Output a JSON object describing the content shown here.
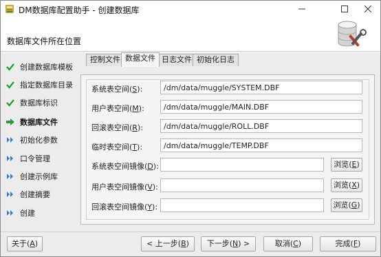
{
  "window": {
    "title": "DM数据库配置助手 - 创建数据库",
    "minimize_icon": "minimize-icon",
    "maximize_icon": "maximize-icon",
    "close_icon": "close-icon"
  },
  "header": {
    "title": "数据库文件所在位置",
    "logo_icon": "database-tools-icon"
  },
  "sidebar": {
    "steps": [
      {
        "label": "创建数据库模板",
        "state": "done",
        "icon": "checkmark-icon"
      },
      {
        "label": "指定数据库目录",
        "state": "done",
        "icon": "checkmark-icon"
      },
      {
        "label": "数据库标识",
        "state": "done",
        "icon": "checkmark-icon"
      },
      {
        "label": "数据库文件",
        "state": "current",
        "icon": "arrow-right-icon"
      },
      {
        "label": "初始化参数",
        "state": "pending",
        "icon": "double-chevron-icon"
      },
      {
        "label": "口令管理",
        "state": "pending",
        "icon": "double-chevron-icon"
      },
      {
        "label": "创建示例库",
        "state": "pending",
        "icon": "double-chevron-icon"
      },
      {
        "label": "创建摘要",
        "state": "pending",
        "icon": "double-chevron-icon"
      },
      {
        "label": "创建",
        "state": "pending",
        "icon": "double-chevron-icon"
      }
    ]
  },
  "tabs": [
    {
      "label": "控制文件",
      "active": false
    },
    {
      "label": "数据文件",
      "active": true
    },
    {
      "label": "日志文件",
      "active": false
    },
    {
      "label": "初始化日志",
      "active": false
    }
  ],
  "form": {
    "rows": [
      {
        "label": "系统表空间",
        "mnemonic": "S",
        "value": "/dm/data/muggle/SYSTEM.DBF"
      },
      {
        "label": "用户表空间",
        "mnemonic": "M",
        "value": "/dm/data/muggle/MAIN.DBF"
      },
      {
        "label": "回滚表空间",
        "mnemonic": "R",
        "value": "/dm/data/muggle/ROLL.DBF"
      },
      {
        "label": "临时表空间",
        "mnemonic": "T",
        "value": "/dm/data/muggle/TEMP.DBF"
      },
      {
        "label": "系统表空间镜像",
        "mnemonic": "D",
        "value": "",
        "browse": "浏览",
        "browse_key": "E"
      },
      {
        "label": "用户表空间镜像",
        "mnemonic": "V",
        "value": "",
        "browse": "浏览",
        "browse_key": "X"
      },
      {
        "label": "回滚表空间镜像",
        "mnemonic": "Y",
        "value": "",
        "browse": "浏览",
        "browse_key": "G"
      }
    ]
  },
  "footer": {
    "about": {
      "label": "关于",
      "key": "A"
    },
    "prev": {
      "label": "< 上一步",
      "key": "B"
    },
    "next": {
      "label": "下一步",
      "key": "N",
      "suffix": " >"
    },
    "cancel": {
      "label": "取消",
      "key": "C"
    },
    "finish": {
      "label": "完成",
      "key": "F"
    }
  },
  "colors": {
    "check": "#1f9b2e",
    "arrow": "#2e9b3a",
    "chevron": "#2f7fd0"
  }
}
